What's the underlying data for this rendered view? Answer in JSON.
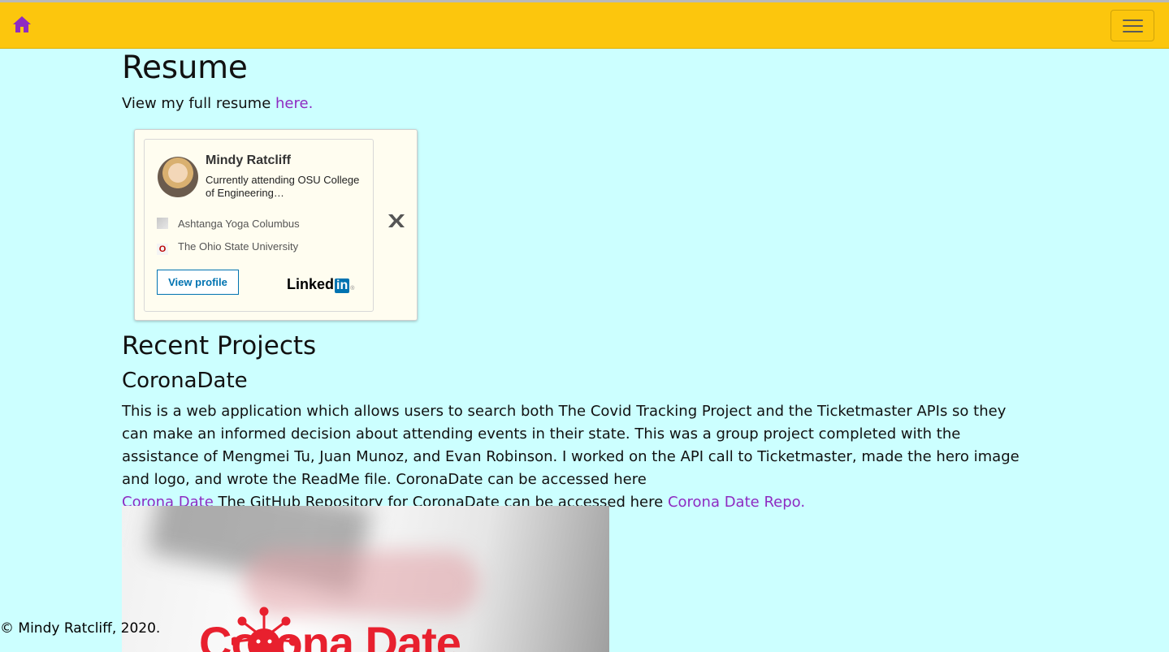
{
  "navbar": {
    "background": "#fcc60d",
    "home_icon": "home-icon",
    "menu_icon": "hamburger-menu-icon"
  },
  "resume": {
    "heading": "Resume",
    "intro_text": "View my full resume ",
    "link_text": "here."
  },
  "linkedin": {
    "name": "Mindy Ratcliff",
    "headline": "Currently attending OSU College of Engineering…",
    "company": "Ashtanga Yoga Columbus",
    "school": "The Ohio State University",
    "view_profile_label": "View profile",
    "logo_text": "Linked",
    "logo_in": "in",
    "close_label": "x"
  },
  "projects": {
    "heading": "Recent Projects",
    "items": [
      {
        "title": "CoronaDate",
        "description": "This is a web application which allows users to search both The Covid Tracking Project and the Ticketmaster APIs so they can make an informed decision about attending events in their state. This was a group project completed with the assistance of Mengmei Tu, Juan Munoz, and Evan Robinson. I worked on the API call to Ticketmaster, made the hero image and logo, and wrote the ReadMe file. CoronaDate can be accessed here ",
        "site_link": "Corona Date",
        "repo_text": " The GitHub Repository for CoronaDate can be accessed here ",
        "repo_link": "Corona Date Repo.",
        "image_text": "Corona Date"
      }
    ]
  },
  "footer": {
    "text": "© Mindy Ratcliff, 2020."
  },
  "colors": {
    "page_bg": "#ccffff",
    "link": "#8e2bc2",
    "accent": "#fcc60d"
  }
}
